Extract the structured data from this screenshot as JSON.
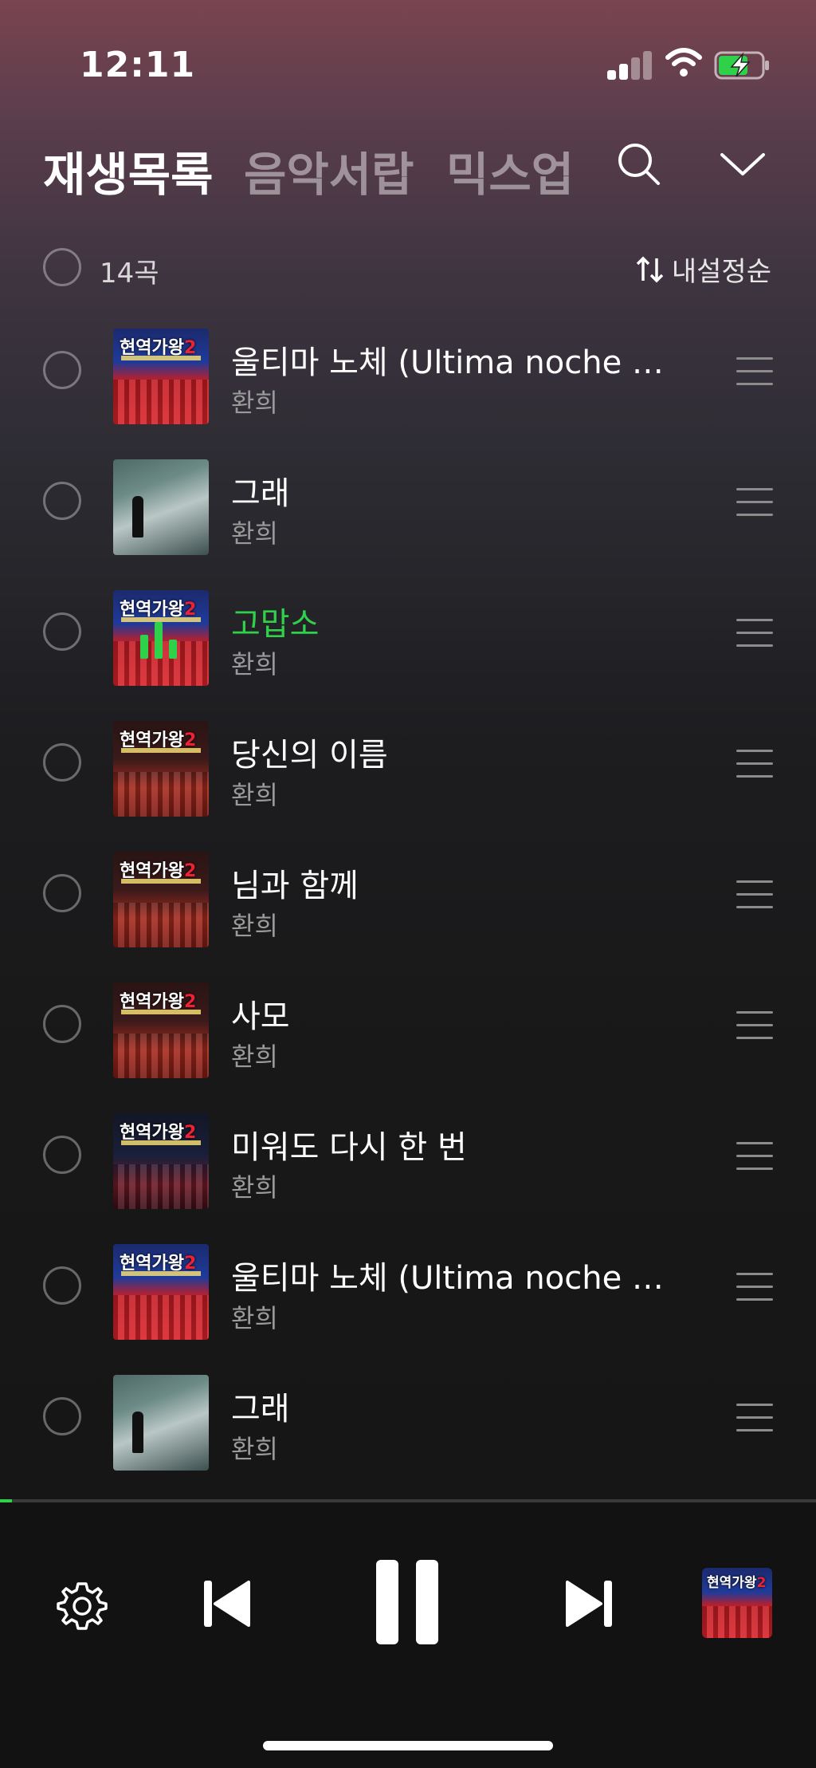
{
  "status": {
    "time": "12:11"
  },
  "tabs": [
    {
      "label": "재생목록",
      "active": true
    },
    {
      "label": "음악서랍",
      "active": false
    },
    {
      "label": "믹스업",
      "active": false
    }
  ],
  "header_icons": [
    "search-icon",
    "chevron-down-icon"
  ],
  "list": {
    "count_label": "14곡",
    "sort_label": "내설정순"
  },
  "tracks": [
    {
      "title": "울티마 노체 (Ultima noche 마지막 밤)",
      "artist": "환희",
      "art": "red",
      "playing": false
    },
    {
      "title": "그래",
      "artist": "환희",
      "art": "road",
      "playing": false
    },
    {
      "title": "고맙소",
      "artist": "환희",
      "art": "red-eq",
      "playing": true
    },
    {
      "title": "당신의 이름",
      "artist": "환희",
      "art": "dark",
      "playing": false
    },
    {
      "title": "님과 함께",
      "artist": "환희",
      "art": "dark",
      "playing": false
    },
    {
      "title": "사모",
      "artist": "환희",
      "art": "dark",
      "playing": false
    },
    {
      "title": "미워도 다시 한 번",
      "artist": "환희",
      "art": "dark2",
      "playing": false
    },
    {
      "title": "울티마 노체 (Ultima noche 마지막 밤)",
      "artist": "환희",
      "art": "red",
      "playing": false
    },
    {
      "title": "그래",
      "artist": "환희",
      "art": "road",
      "playing": false
    }
  ],
  "player": {
    "progress": 0.015,
    "controls": [
      "settings-icon",
      "previous-icon",
      "pause-icon",
      "next-icon"
    ]
  },
  "colors": {
    "accent_green": "#2fd04a",
    "inactive_tab": "rgba(255,255,255,0.45)"
  }
}
